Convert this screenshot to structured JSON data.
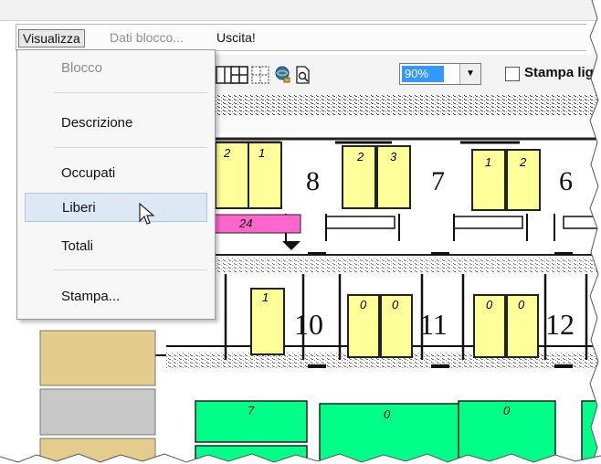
{
  "menubar": {
    "items": [
      {
        "label": "Visualizza",
        "state": "active"
      },
      {
        "label": "Dati blocco...",
        "state": "disabled"
      },
      {
        "label": "Uscita!",
        "state": "normal"
      }
    ]
  },
  "dropdown": {
    "items": [
      {
        "label": "Blocco",
        "disabled": true
      },
      {
        "label": "Descrizione",
        "disabled": false
      },
      {
        "label": "Occupati",
        "disabled": false
      },
      {
        "label": "Liberi",
        "disabled": false,
        "hover": true
      },
      {
        "label": "Totali",
        "disabled": false
      },
      {
        "label": "Stampa...",
        "disabled": false
      }
    ]
  },
  "toolbar": {
    "zoom_value": "90%",
    "print_checkbox_label": "Stampa lig"
  },
  "plan": {
    "block_numbers_top": [
      "8",
      "7",
      "6"
    ],
    "block_numbers_bottom": [
      "10",
      "11",
      "12"
    ],
    "top_cells": [
      "2",
      "1",
      "2",
      "3",
      "1",
      "2"
    ],
    "pink_value": "24",
    "mid_cells": [
      "1",
      "0",
      "0",
      "0",
      "0"
    ],
    "green_cells": [
      "7",
      "0",
      "0"
    ]
  },
  "colors": {
    "cell_yellow": "#ffff99",
    "cell_pink": "#ff66cc",
    "cell_green": "#00ff88",
    "swatch_tan": "#e3cc8c",
    "swatch_gray": "#c8c8c8",
    "zoom_highlight": "#3399ff"
  }
}
